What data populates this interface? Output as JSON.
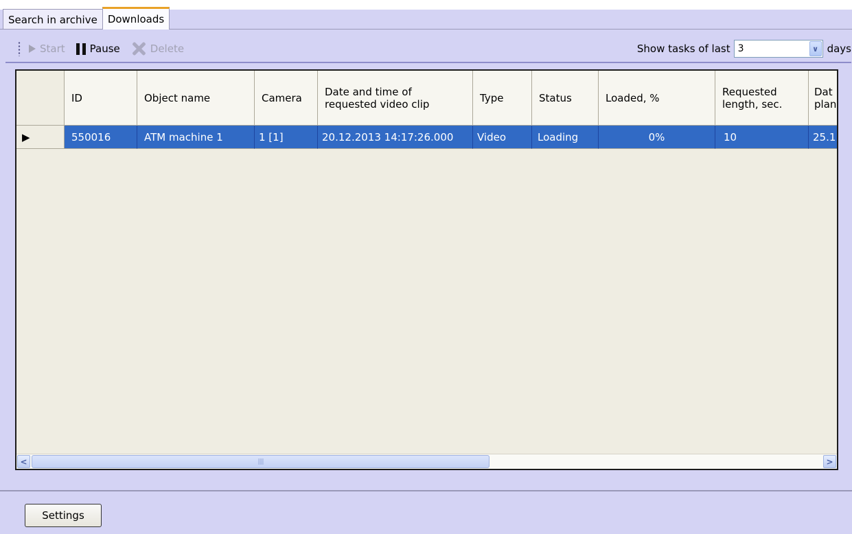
{
  "tabs": [
    {
      "label": "Search in archive",
      "active": false
    },
    {
      "label": "Downloads",
      "active": true
    }
  ],
  "toolbar": {
    "start_label": "Start",
    "pause_label": "Pause",
    "delete_label": "Delete",
    "show_tasks_label": "Show tasks of last",
    "days_value": "3",
    "days_label": "days"
  },
  "table": {
    "columns": [
      "ID",
      "Object name",
      "Camera",
      "Date and time of\nrequested video clip",
      "Type",
      "Status",
      "Loaded, %",
      "Requested\nlength, sec.",
      "Dat\nplan"
    ],
    "rows": [
      [
        "550016",
        "ATM machine 1",
        "1 [1]",
        "20.12.2013 14:17:26.000",
        "Video",
        "Loading",
        "0%",
        "10",
        "25.1"
      ]
    ]
  },
  "settings_label": "Settings",
  "colors": {
    "background": "#d4d3f4",
    "selection": "#316ac5",
    "active_tab_accent": "#e9a227"
  }
}
